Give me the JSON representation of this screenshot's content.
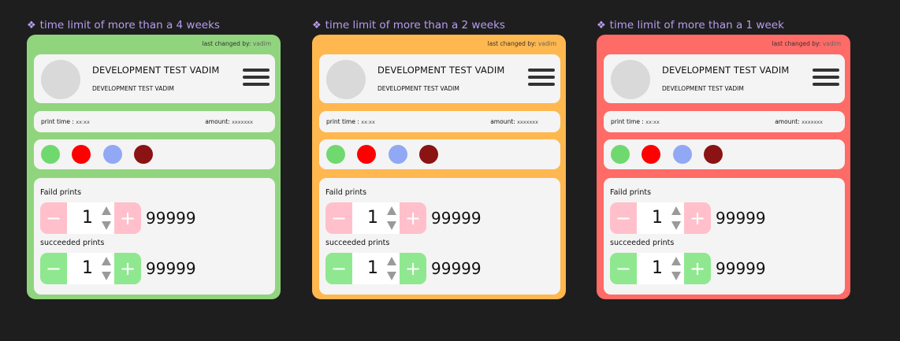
{
  "colors": {
    "background": "#1e1e1e",
    "frame_title": "#b79cf0",
    "red_button": "#ffc0cb",
    "green_button": "#8fe88f"
  },
  "cards": [
    {
      "frame_title": "time limit of more than a 4 weeks",
      "card_color": "#91d47e",
      "last_changed_label": "last changed by:",
      "last_changed_user": "vadim",
      "title": "DEVELOPMENT TEST VADIM",
      "subtitle": "DEVELOPMENT TEST VADIM",
      "menu_icon": "hamburger-menu-icon",
      "print_time_label": "print time :",
      "print_time_value": "xx:xx",
      "amount_label": "amount:",
      "amount_value": "xxxxxxx",
      "color_dots": [
        "#6fd96f",
        "#ff0000",
        "#91a8f5",
        "#8b1313"
      ],
      "failed_label": "Faild prints",
      "failed_minus": "−",
      "failed_value": "1",
      "failed_plus": "+",
      "failed_total": "99999",
      "succeeded_label": "succeeded prints",
      "succeeded_minus": "−",
      "succeeded_value": "1",
      "succeeded_plus": "+",
      "succeeded_total": "99999"
    },
    {
      "frame_title": "time limit of more than a 2 weeks",
      "card_color": "#ffb74f",
      "last_changed_label": "last changed by:",
      "last_changed_user": "vadim",
      "title": "DEVELOPMENT TEST VADIM",
      "subtitle": "DEVELOPMENT TEST VADIM",
      "menu_icon": "hamburger-menu-icon",
      "print_time_label": "print time :",
      "print_time_value": "xx:xx",
      "amount_label": "amount:",
      "amount_value": "xxxxxxx",
      "color_dots": [
        "#6fd96f",
        "#ff0000",
        "#91a8f5",
        "#8b1313"
      ],
      "failed_label": "Faild prints",
      "failed_minus": "−",
      "failed_value": "1",
      "failed_plus": "+",
      "failed_total": "99999",
      "succeeded_label": "succeeded prints",
      "succeeded_minus": "−",
      "succeeded_value": "1",
      "succeeded_plus": "+",
      "succeeded_total": "99999"
    },
    {
      "frame_title": "time limit of more than a 1 week",
      "card_color": "#ff6b66",
      "last_changed_label": "last changed by:",
      "last_changed_user": "vadim",
      "title": "DEVELOPMENT TEST VADIM",
      "subtitle": "DEVELOPMENT TEST VADIM",
      "menu_icon": "hamburger-menu-icon",
      "print_time_label": "print time :",
      "print_time_value": "xx:xx",
      "amount_label": "amount:",
      "amount_value": "xxxxxxx",
      "color_dots": [
        "#6fd96f",
        "#ff0000",
        "#91a8f5",
        "#8b1313"
      ],
      "failed_label": "Faild prints",
      "failed_minus": "−",
      "failed_value": "1",
      "failed_plus": "+",
      "failed_total": "99999",
      "succeeded_label": "succeeded prints",
      "succeeded_minus": "−",
      "succeeded_value": "1",
      "succeeded_plus": "+",
      "succeeded_total": "99999"
    }
  ]
}
